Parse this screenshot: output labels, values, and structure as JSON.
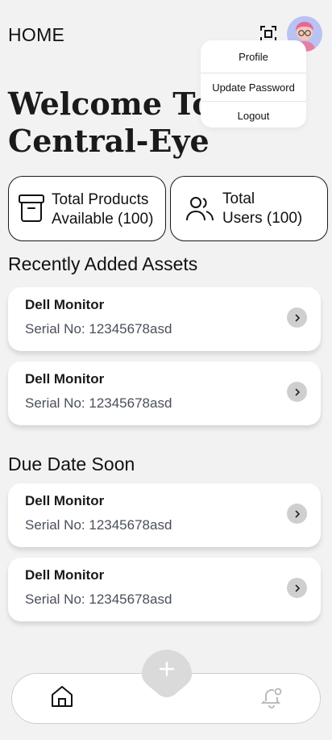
{
  "header": {
    "title": "HOME"
  },
  "dropdown": {
    "items": [
      "Profile",
      "Update Password",
      "Logout"
    ]
  },
  "welcome": {
    "line1": "Welcome To",
    "line2": "Central-Eye"
  },
  "stats": {
    "products": {
      "line1": "Total Products",
      "line2": "Available (100)"
    },
    "users": {
      "line1": "Total",
      "line2": "Users (100)"
    }
  },
  "recent": {
    "title": "Recently Added Assets",
    "items": [
      {
        "name": "Dell Monitor",
        "serial": "Serial No: 12345678asd"
      },
      {
        "name": "Dell Monitor",
        "serial": "Serial No: 12345678asd"
      }
    ]
  },
  "due": {
    "title": "Due Date Soon",
    "items": [
      {
        "name": "Dell Monitor",
        "serial": "Serial No: 12345678asd"
      },
      {
        "name": "Dell Monitor",
        "serial": "Serial No: 12345678asd"
      }
    ]
  },
  "icons": {
    "scan": "scan-icon",
    "home": "home-icon",
    "bell": "notification-bell-icon",
    "plus": "plus-icon",
    "chevron": "chevron-right-icon",
    "archive": "archive-box-icon",
    "users": "users-icon"
  },
  "colors": {
    "background": "#f2f2f2",
    "avatar_bg": "#b9c3f2",
    "serial_text": "#4a4f5c"
  }
}
